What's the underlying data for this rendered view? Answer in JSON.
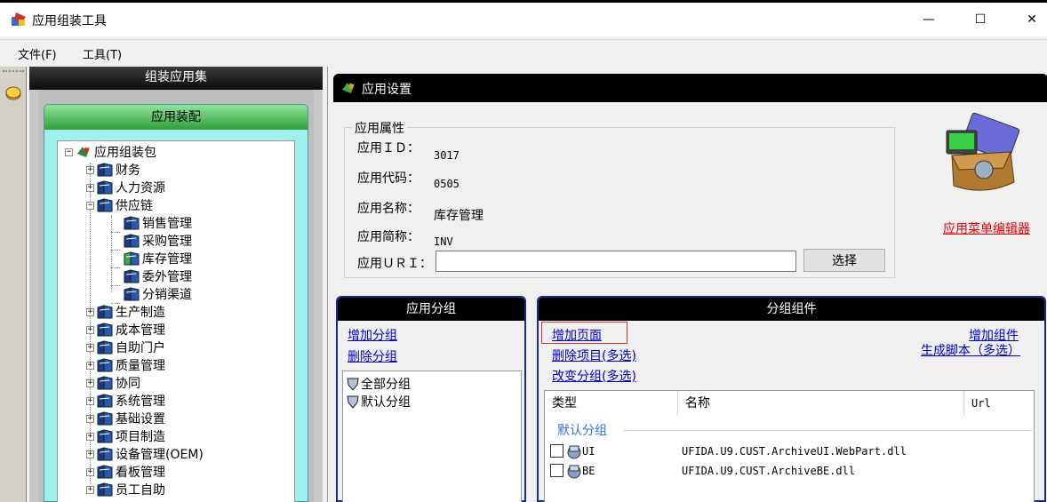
{
  "window": {
    "title": "应用组装工具",
    "controls": {
      "minimize": "—",
      "maximize": "☐",
      "close": "✕"
    }
  },
  "menu": {
    "file": "文件(F)",
    "tools": "工具(T)"
  },
  "group_panel": {
    "header": "组装应用集",
    "assembly_header": "应用装配",
    "tree": {
      "root": "应用组装包",
      "items": [
        {
          "label": "财务",
          "expander": "+"
        },
        {
          "label": "人力资源",
          "expander": "+"
        },
        {
          "label": "供应链",
          "expander": "−"
        },
        {
          "label": "销售管理"
        },
        {
          "label": "采购管理"
        },
        {
          "label": "库存管理"
        },
        {
          "label": "委外管理"
        },
        {
          "label": "分销渠道"
        },
        {
          "label": "生产制造",
          "expander": "+"
        },
        {
          "label": "成本管理",
          "expander": "+"
        },
        {
          "label": "自助门户",
          "expander": "+"
        },
        {
          "label": "质量管理",
          "expander": "+"
        },
        {
          "label": "协同",
          "expander": "+"
        },
        {
          "label": "系统管理",
          "expander": "+"
        },
        {
          "label": "基础设置",
          "expander": "+"
        },
        {
          "label": "项目制造",
          "expander": "+"
        },
        {
          "label": "设备管理(OEM)",
          "expander": "+"
        },
        {
          "label": "看板管理",
          "expander": "+"
        },
        {
          "label": "员工自助",
          "expander": "+"
        }
      ]
    }
  },
  "settings": {
    "title": "应用设置",
    "props_legend": "应用属性",
    "fields": {
      "id_label": "应用ＩＤ：",
      "id_value": "3017",
      "code_label": "应用代码：",
      "code_value": "0505",
      "name_label": "应用名称：",
      "name_value": "库存管理",
      "short_label": "应用简称：",
      "short_value": "INV",
      "uri_label": "应用ＵＲＩ：",
      "uri_value": ""
    },
    "select_button": "选择",
    "menu_editor_link": "应用菜单编辑器"
  },
  "app_group": {
    "header": "应用分组",
    "add_group": "增加分组",
    "delete_group": "删除分组",
    "items": [
      "全部分组",
      "默认分组"
    ]
  },
  "components": {
    "header": "分组组件",
    "add_page": "增加页面",
    "delete_items": "删除项目(多选)",
    "change_group": "改变分组(多选)",
    "add_component": "增加组件",
    "gen_script": "生成脚本（多选）",
    "columns": [
      "类型",
      "名称",
      "Url"
    ],
    "section": "默认分组",
    "rows": [
      {
        "type": "UI",
        "name": "UFIDA.U9.CUST.ArchiveUI.WebPart.dll"
      },
      {
        "type": "BE",
        "name": "UFIDA.U9.CUST.ArchiveBE.dll"
      }
    ]
  },
  "colors": {
    "accent_blue": "#0000cc",
    "link_red": "#e00000",
    "assembly_bg": "#9ff0ec",
    "panel_border": "#1c2a8a"
  }
}
